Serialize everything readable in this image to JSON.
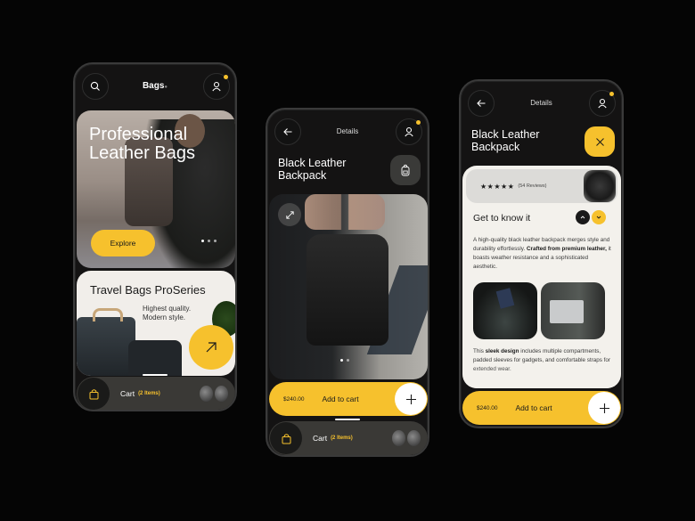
{
  "colors": {
    "accent": "#f6c12d",
    "background": "#050505",
    "phone": "#141313",
    "card": "#f3f1ec"
  },
  "screen_home": {
    "header": {
      "title": "Bags",
      "search_icon": "search-icon",
      "profile_icon": "user-icon"
    },
    "hero": {
      "title": "Professional Leather Bags",
      "cta": "Explore",
      "slides": 3,
      "active_slide": 1
    },
    "promo": {
      "title": "Travel Bags ProSeries",
      "subtitle": "Highest quality. Modern style.",
      "action_icon": "arrow-up-right-icon"
    },
    "cart": {
      "label": "Cart",
      "count": "(2 Items)"
    }
  },
  "screen_details": {
    "header": {
      "title": "Details",
      "back_icon": "arrow-left-icon",
      "profile_icon": "user-icon"
    },
    "product": {
      "name": "Black Leather Backpack",
      "slides": 2,
      "active_slide": 1
    },
    "add_to_cart": {
      "price": "$240.00",
      "label": "Add to cart"
    },
    "cart": {
      "label": "Cart",
      "count": "(2 Items)"
    }
  },
  "screen_details_expanded": {
    "header": {
      "title": "Details",
      "back_icon": "arrow-left-icon",
      "profile_icon": "user-icon"
    },
    "product": {
      "name": "Black Leather Backpack"
    },
    "rating": {
      "stars": "★★★★★",
      "value": 5,
      "reviews": "(54 Reviews)"
    },
    "section_title": "Get to know it",
    "description_1": {
      "pre": "A high-quality black leather backpack merges style and durability effortlessly. ",
      "bold": "Crafted from premium leather,",
      "post": " it boasts weather resistance and a sophisticated aesthetic."
    },
    "description_2": {
      "pre": "This ",
      "bold": "sleek design",
      "post": " includes multiple compartments, padded sleeves for gadgets, and comfortable straps for extended wear."
    },
    "add_to_cart": {
      "price": "$240.00",
      "label": "Add to cart"
    }
  }
}
